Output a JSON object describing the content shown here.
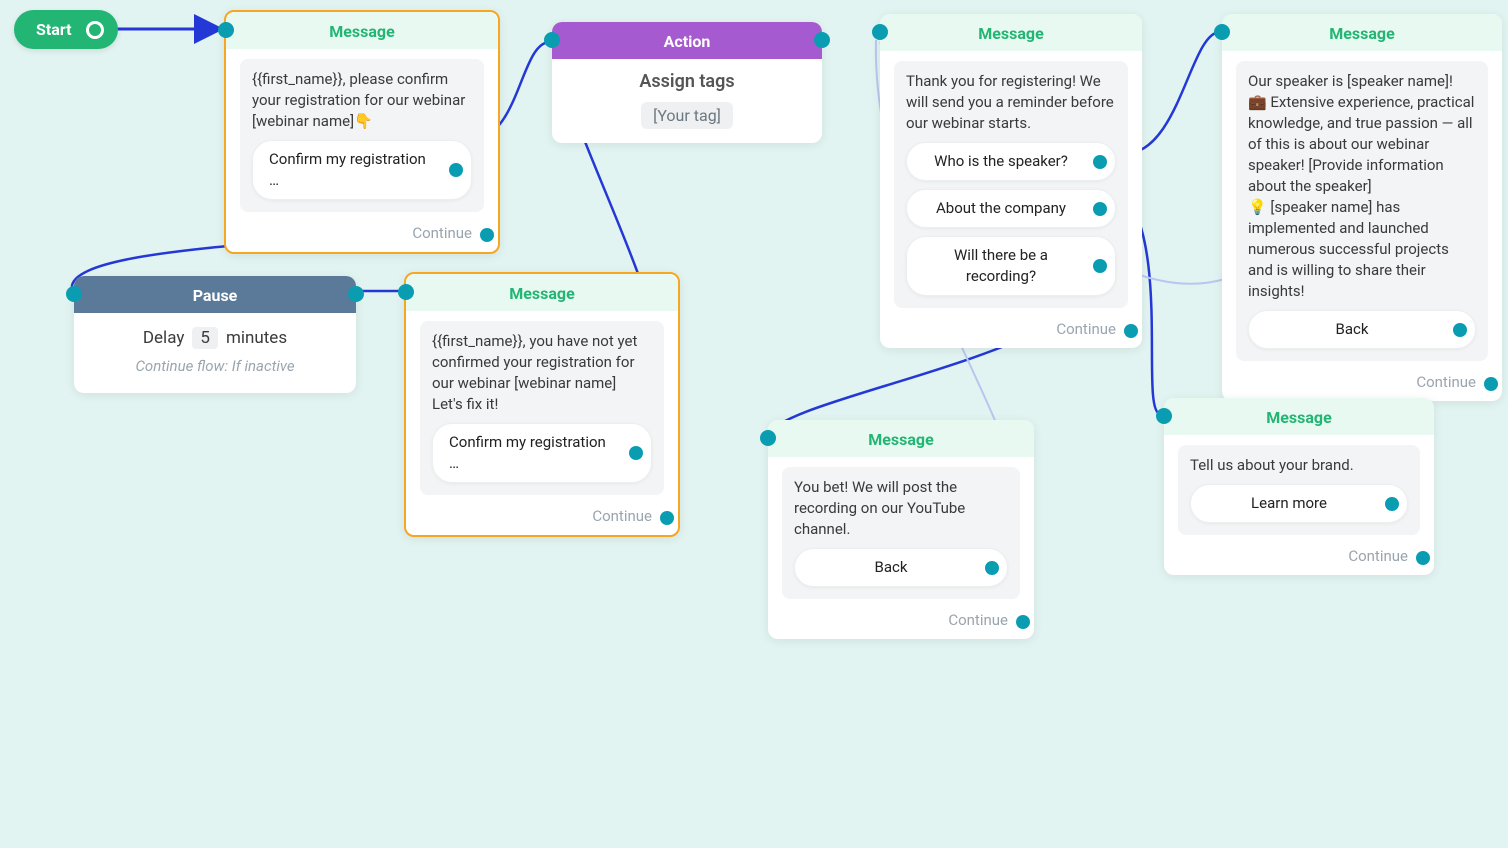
{
  "start": {
    "label": "Start"
  },
  "nodes": {
    "msg1": {
      "title": "Message",
      "text": "{{first_name}}, please confirm your registration for our webinar [webinar name]👇",
      "buttons": [
        "Confirm my registration …"
      ],
      "continue": "Continue"
    },
    "action1": {
      "title": "Action",
      "action_label": "Assign tags",
      "tag": "[Your tag]"
    },
    "msg_thanks": {
      "title": "Message",
      "text": "Thank you for registering! We will send you a reminder before our webinar starts.",
      "buttons": [
        "Who is the speaker?",
        "About the company",
        "Will there be a recording?"
      ],
      "continue": "Continue"
    },
    "msg_speaker": {
      "title": "Message",
      "text": "Our speaker is [speaker name]!\n💼  Extensive experience, practical knowledge, and true passion — all of this is about our webinar speaker! [Provide information about the speaker]\n💡  [speaker name] has implemented and launched numerous successful projects and is willing to share their insights!",
      "buttons": [
        "Back"
      ],
      "continue": "Continue"
    },
    "pause1": {
      "title": "Pause",
      "delay_word": "Delay",
      "delay_value": "5",
      "delay_unit": "minutes",
      "sub": "Continue flow: If inactive"
    },
    "msg_remind": {
      "title": "Message",
      "text": "{{first_name}}, you have not yet confirmed your registration for our webinar [webinar name]\nLet's fix it!",
      "buttons": [
        "Confirm my registration …"
      ],
      "continue": "Continue"
    },
    "msg_recording": {
      "title": "Message",
      "text": "You bet! We will post the recording on our YouTube channel.",
      "buttons": [
        "Back"
      ],
      "continue": "Continue"
    },
    "msg_brand": {
      "title": "Message",
      "text": "Tell us about your brand.",
      "buttons": [
        "Learn more"
      ],
      "continue": "Continue"
    }
  }
}
